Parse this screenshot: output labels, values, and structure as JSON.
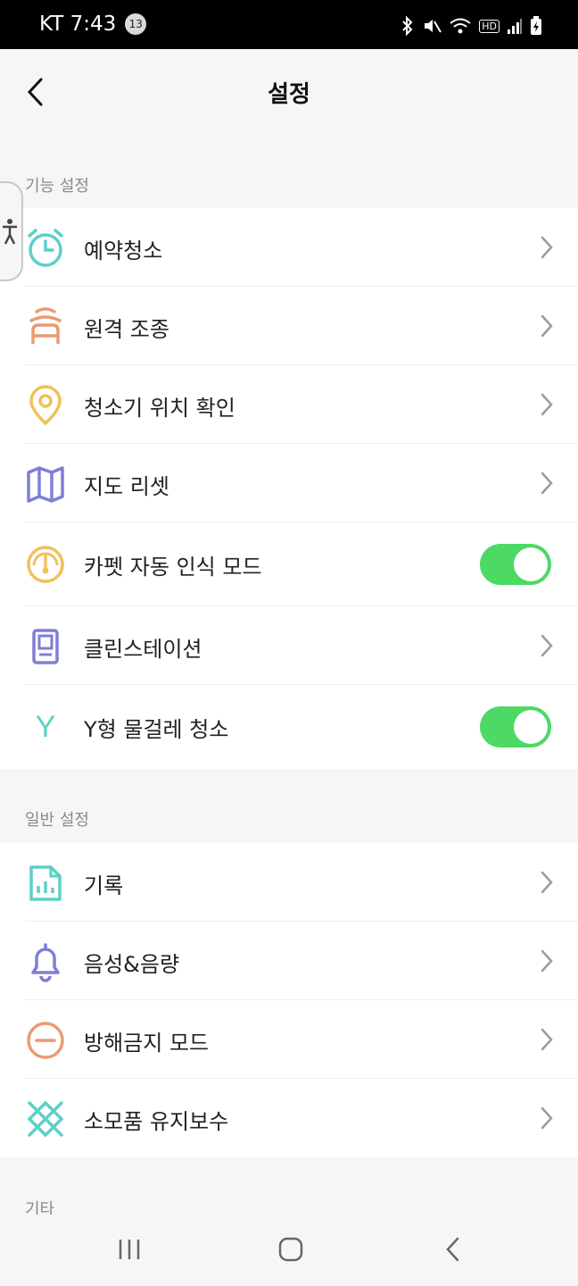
{
  "status_bar": {
    "carrier_time": "KT 7:43",
    "notification_count": "13",
    "network_label": "HD"
  },
  "header": {
    "title": "설정"
  },
  "sections": {
    "function": {
      "title": "기능 설정",
      "items": [
        {
          "label": "예약청소",
          "icon": "alarm-clock-icon",
          "control": "chevron"
        },
        {
          "label": "원격 조종",
          "icon": "remote-control-icon",
          "control": "chevron"
        },
        {
          "label": "청소기 위치 확인",
          "icon": "location-pin-icon",
          "control": "chevron"
        },
        {
          "label": "지도 리셋",
          "icon": "map-icon",
          "control": "chevron"
        },
        {
          "label": "카펫 자동 인식 모드",
          "icon": "gauge-icon",
          "control": "toggle",
          "on": true
        },
        {
          "label": "클린스테이션",
          "icon": "station-icon",
          "control": "chevron"
        },
        {
          "label": "Y형 물걸레 청소",
          "icon": "y-letter-icon",
          "icon_text": "Y",
          "control": "toggle",
          "on": true
        }
      ]
    },
    "general": {
      "title": "일반 설정",
      "items": [
        {
          "label": "기록",
          "icon": "record-chart-icon",
          "control": "chevron"
        },
        {
          "label": "음성&음량",
          "icon": "bell-icon",
          "control": "chevron"
        },
        {
          "label": "방해금지 모드",
          "icon": "do-not-disturb-icon",
          "control": "chevron"
        },
        {
          "label": "소모품 유지보수",
          "icon": "consumables-icon",
          "control": "chevron"
        }
      ]
    },
    "other": {
      "title": "기타"
    }
  },
  "colors": {
    "toggle_on": "#4cd964",
    "teal": "#5ccfc9",
    "orange": "#eb9a73",
    "yellow": "#f0c05a",
    "purple": "#7d7fd6"
  }
}
